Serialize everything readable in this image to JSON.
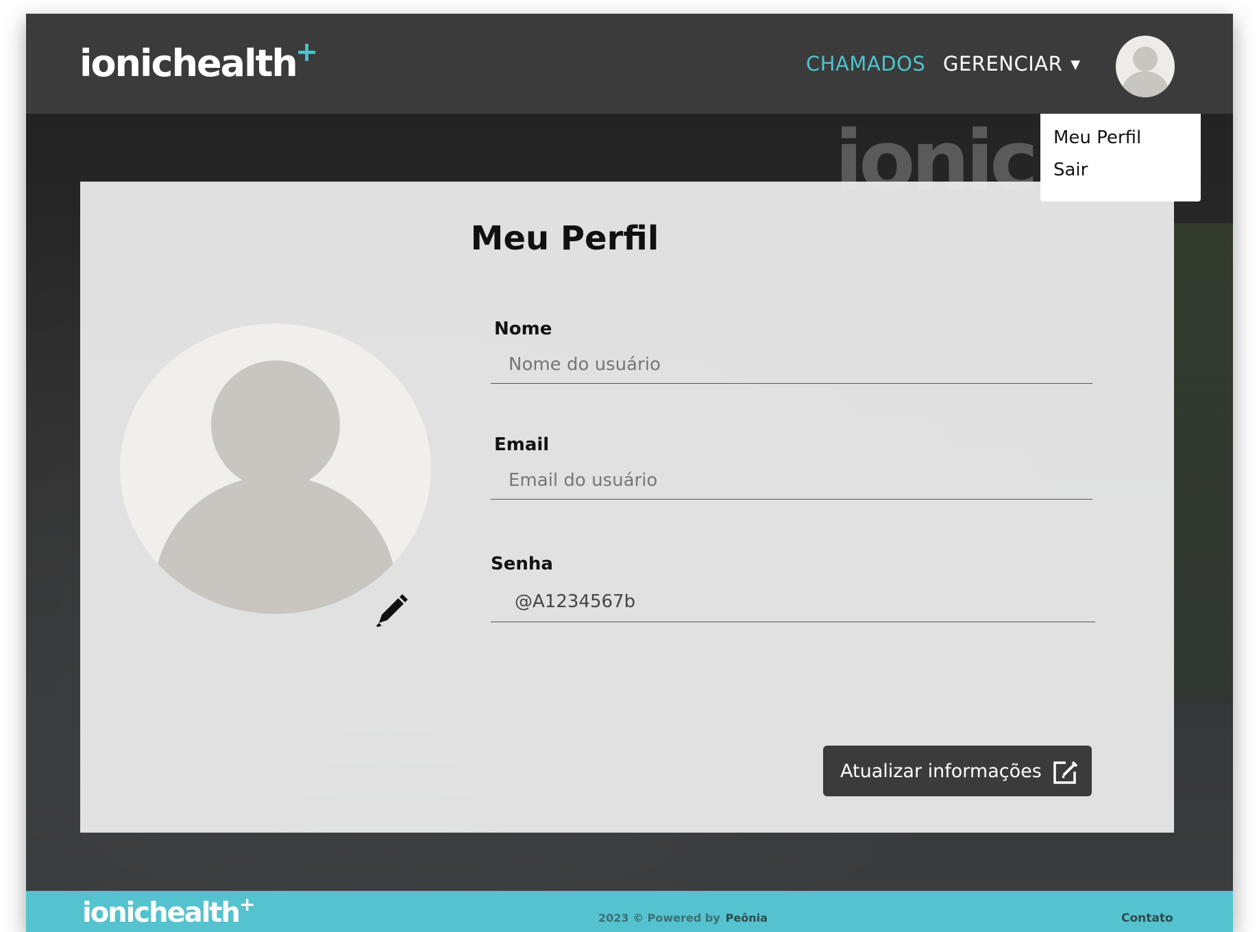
{
  "header": {
    "logo_text": "ionichealth",
    "logo_plus": "+",
    "nav": {
      "chamados": "CHAMADOS",
      "gerenciar": "GERENCIAR",
      "caret": "▼"
    }
  },
  "dropdown": {
    "items": [
      "Meu Perfil",
      "Sair"
    ]
  },
  "background": {
    "sign_text": "ionic"
  },
  "profile": {
    "title": "Meu Perfil",
    "fields": {
      "nome": {
        "label": "Nome",
        "placeholder": "Nome do usuário",
        "value": ""
      },
      "email": {
        "label": "Email",
        "placeholder": "Email do usuário",
        "value": ""
      },
      "senha": {
        "label": "Senha",
        "value": "@A1234567b"
      }
    },
    "update_button": "Atualizar informações"
  },
  "footer": {
    "logo_text": "ionichealth",
    "logo_plus": "+",
    "copyright": "2023 © Powered by",
    "brand": "Peônia",
    "contato": "Contato"
  },
  "colors": {
    "accent": "#4fc3cf",
    "header_bg": "#3b3b3b",
    "footer_bg": "#54c3cf",
    "button_bg": "#3b3b3b"
  },
  "icons": [
    "user-avatar-icon",
    "pencil-icon",
    "edit-square-icon",
    "chevron-down-icon"
  ]
}
